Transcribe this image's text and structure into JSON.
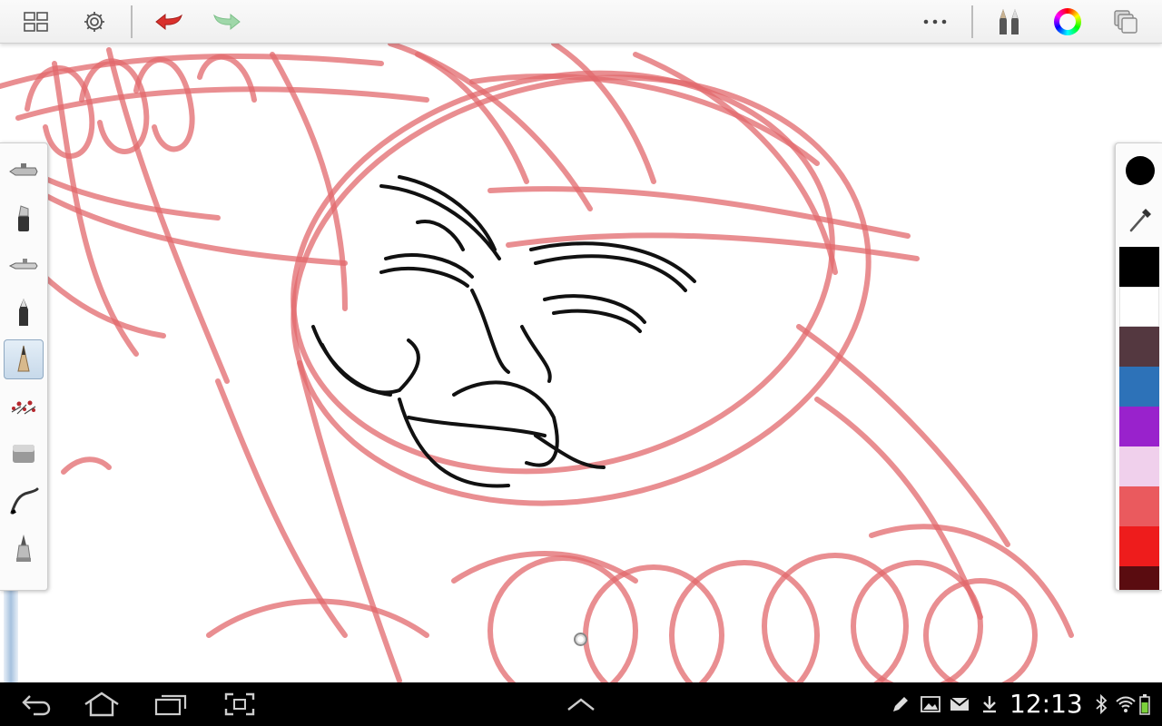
{
  "toolbar": {
    "left": [
      "gallery-icon",
      "settings-icon",
      "undo-icon",
      "redo-icon"
    ],
    "right": [
      "more-icon",
      "brushes-icon",
      "color-wheel-icon",
      "layers-icon"
    ]
  },
  "tools": [
    "airbrush-icon",
    "marker-icon",
    "airbrush-alt-icon",
    "ballpoint-pen-icon",
    "pencil-icon",
    "splatter-brush-icon",
    "eraser-icon",
    "smudge-icon",
    "paint-brush-icon"
  ],
  "active_tool": "pencil-icon",
  "colors": {
    "current": "#000000",
    "accent_sketch": "#e2686c",
    "swatches": [
      "#000000",
      "#ffffff",
      "#543840",
      "#2d72b8",
      "#9922cc",
      "#f0d0ec",
      "#ea5a5e",
      "#ee1c1c",
      "#5a0c10"
    ]
  },
  "statusbar": {
    "clock": "12:13",
    "nav": [
      "back-icon",
      "home-icon",
      "recent-apps-icon",
      "screenshot-icon",
      "expand-up-icon"
    ],
    "notifications": [
      "pen-icon",
      "gallery-icon",
      "mail-icon",
      "download-icon"
    ],
    "system": [
      "bluetooth-icon",
      "wifi-icon",
      "battery-icon"
    ]
  }
}
